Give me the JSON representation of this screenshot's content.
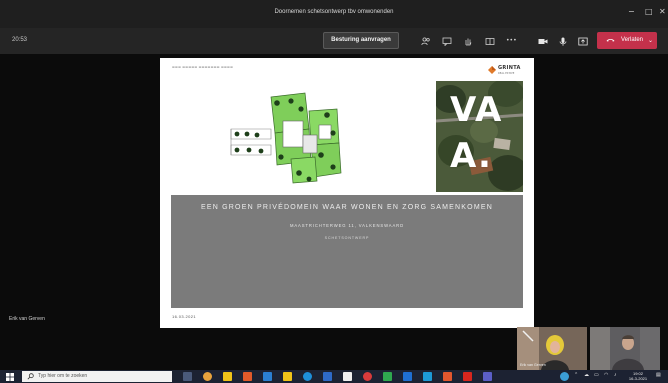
{
  "window": {
    "title": "Doornemen schetsontwerp tbv omwonenden",
    "minimize": "−",
    "maximize": "□",
    "close": "✕"
  },
  "toolbar": {
    "timer": "20:53",
    "control_button": "Besturing aanvragen",
    "more": "•••",
    "leave_label": "Verlaten"
  },
  "presenter_name": "Erik van Gerven",
  "slide": {
    "brand_name": "GRINTA",
    "brand_sub": "REAL ESTATE",
    "aerial_line1": "VA",
    "aerial_line2": "A.",
    "heading": "EEN GROEN PRIVÉDOMEIN WAAR WONEN EN ZORG SAMENKOMEN",
    "address": "MAASTRICHTERWEG 11, VALKENSWAARD",
    "subtitle": "SCHETSONTWERP",
    "date": "16.03.2021"
  },
  "participants": [
    {
      "name": "Erik van Gerven"
    }
  ],
  "taskbar": {
    "search_placeholder": "Typ hier om te zoeken",
    "time": "19:02",
    "date": "16-3-2021"
  },
  "colors": {
    "leave_red": "#c4314b",
    "plan_green": "#7fce5a",
    "banner_gray": "#7b7b7b",
    "taskbar": "#1c2232"
  }
}
